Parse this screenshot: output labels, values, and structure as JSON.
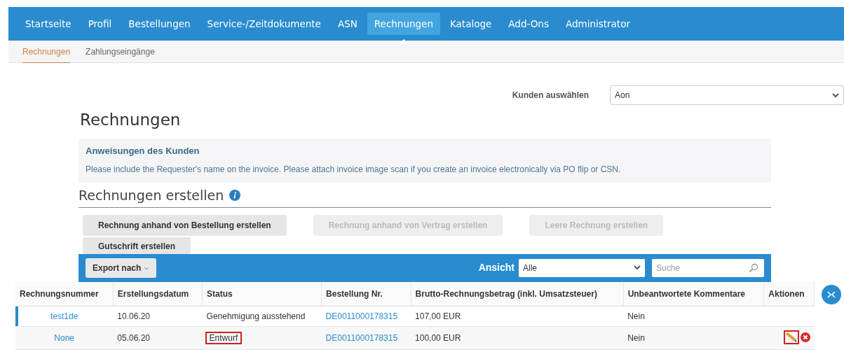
{
  "nav": [
    {
      "label": "Startseite",
      "selected": false
    },
    {
      "label": "Profil",
      "selected": false
    },
    {
      "label": "Bestellungen",
      "selected": false
    },
    {
      "label": "Service-/Zeitdokumente",
      "selected": false
    },
    {
      "label": "ASN",
      "selected": false
    },
    {
      "label": "Rechnungen",
      "selected": true
    },
    {
      "label": "Kataloge",
      "selected": false
    },
    {
      "label": "Add-Ons",
      "selected": false
    },
    {
      "label": "Administrator",
      "selected": false
    }
  ],
  "subnav": [
    {
      "label": "Rechnungen",
      "selected": true
    },
    {
      "label": "Zahlungseingänge",
      "selected": false
    }
  ],
  "customer_select": {
    "label": "Kunden auswählen",
    "value": "Aon"
  },
  "page_title": "Rechnungen",
  "instructions": {
    "title": "Anweisungen des Kunden",
    "text": "Please include the Requester's name on the invoice. Please attach invoice image scan if you create an invoice electronically via PO flip or CSN."
  },
  "create_section": {
    "title": "Rechnungen erstellen"
  },
  "create_buttons": [
    {
      "label": "Rechnung anhand von Bestellung erstellen",
      "disabled": false
    },
    {
      "label": "Rechnung anhand von Vertrag erstellen",
      "disabled": true
    },
    {
      "label": "Leere Rechnung erstellen",
      "disabled": true
    },
    {
      "label": "Gutschrift erstellen",
      "disabled": false
    }
  ],
  "toolbar": {
    "export_label": "Export nach",
    "view_label": "Ansicht",
    "view_value": "Alle",
    "search_placeholder": "Suche"
  },
  "table": {
    "columns": [
      "Rechnungsnummer",
      "Erstellungsdatum",
      "Status",
      "Bestellung Nr.",
      "Brutto-Rechnungsbetrag (inkl. Umsatzsteuer)",
      "Unbeantwortete Kommentare",
      "Aktionen"
    ],
    "rows": [
      {
        "selected": true,
        "number": "test1de",
        "date": "10.06.20",
        "status": "Genehmigung ausstehend",
        "status_highlighted": false,
        "order": "DE0011000178315",
        "amount": "107,00 EUR",
        "comments": "Nein",
        "actions": false
      },
      {
        "selected": false,
        "number": "None",
        "date": "05.06.20",
        "status": "Entwurf",
        "status_highlighted": true,
        "order": "DE0011000178315",
        "amount": "100,00 EUR",
        "comments": "Nein",
        "actions": true,
        "actions_highlighted": true
      }
    ]
  }
}
